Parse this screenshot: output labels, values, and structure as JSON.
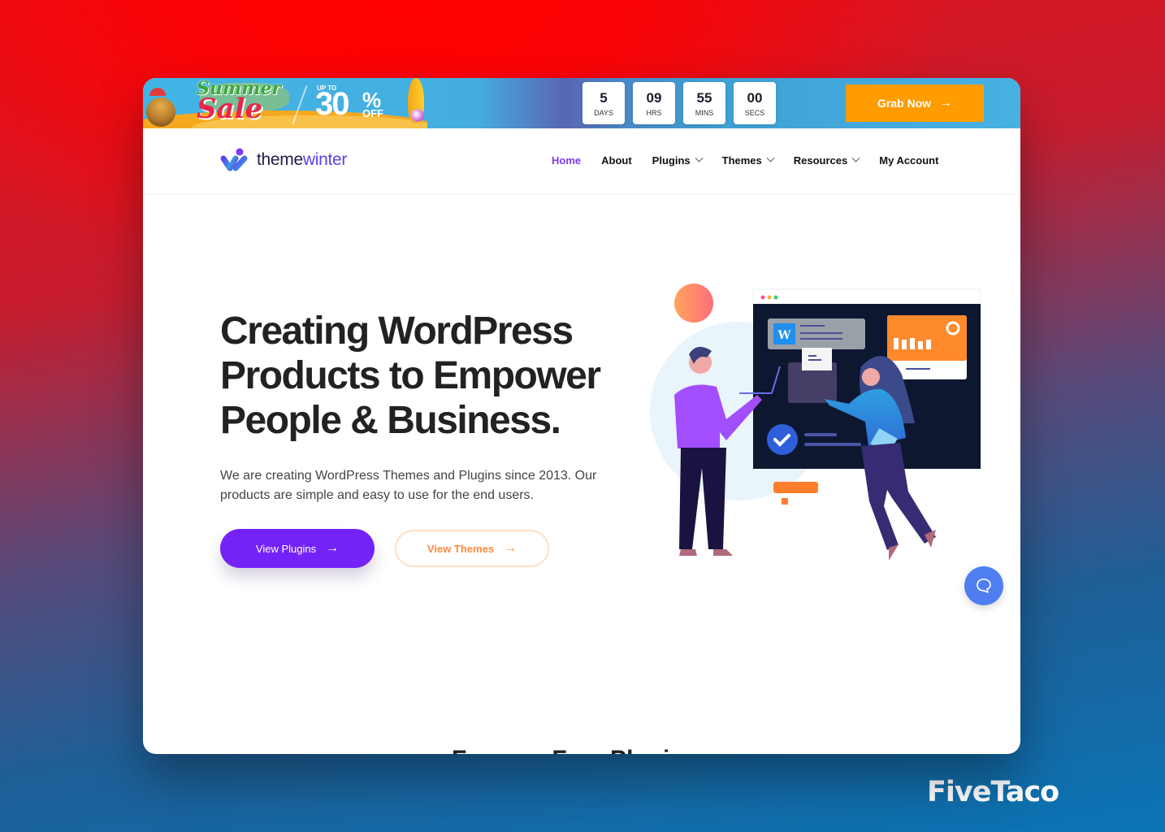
{
  "watermark": "FiveTaco",
  "promo": {
    "summer": "Summer",
    "sale": "Sale",
    "up_to": "UP TO",
    "discount": "30",
    "percent": "%",
    "off": "OFF",
    "countdown": [
      {
        "value": "5",
        "label": "DAYS"
      },
      {
        "value": "09",
        "label": "HRS"
      },
      {
        "value": "55",
        "label": "MINS"
      },
      {
        "value": "00",
        "label": "SECS"
      }
    ],
    "cta_label": "Grab Now",
    "cta_icon": "arrow-right-icon",
    "colors": {
      "cta": "#ff9c00",
      "banner": "#45aee0"
    }
  },
  "header": {
    "logo_text_a": "theme",
    "logo_text_b": "winter",
    "nav": [
      {
        "label": "Home",
        "active": true,
        "dropdown": false
      },
      {
        "label": "About",
        "active": false,
        "dropdown": false
      },
      {
        "label": "Plugins",
        "active": false,
        "dropdown": true
      },
      {
        "label": "Themes",
        "active": false,
        "dropdown": true
      },
      {
        "label": "Resources",
        "active": false,
        "dropdown": true
      },
      {
        "label": "My Account",
        "active": false,
        "dropdown": false
      }
    ],
    "colors": {
      "active": "#7a3cf6"
    }
  },
  "hero": {
    "title": "Creating WordPress Products to Empower People & Business.",
    "description": "We are creating WordPress Themes and Plugins since 2013. Our products are simple and easy to use for the end users.",
    "primary_button": "View Plugins",
    "secondary_button": "View Themes",
    "colors": {
      "primary": "#7323f7",
      "secondary": "#ff8a3d"
    }
  },
  "next_section_heading": "Famous Free Plugins",
  "chat": {
    "icon": "chat-bubble-icon"
  }
}
